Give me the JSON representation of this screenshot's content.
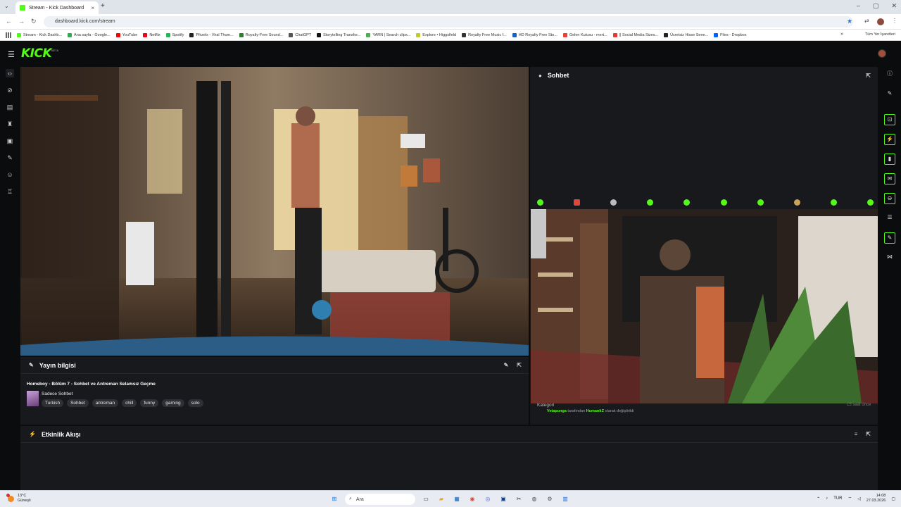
{
  "browser": {
    "tab_title": "Stream - Kick Dashboard",
    "url": "dashboard.kick.com/stream",
    "bookmarks": [
      {
        "label": "Stream - Kick Dashb...",
        "color": "#53fc18"
      },
      {
        "label": "Ana sayfa - Google...",
        "color": "#34a853"
      },
      {
        "label": "YouTube",
        "color": "#ff0000"
      },
      {
        "label": "Netflix",
        "color": "#e50914"
      },
      {
        "label": "Spotify",
        "color": "#1db954"
      },
      {
        "label": "Pikzels - Viral Thum...",
        "color": "#222222"
      },
      {
        "label": "Royalty-Free Sound...",
        "color": "#2e7d32"
      },
      {
        "label": "ChatGPT",
        "color": "#555555"
      },
      {
        "label": "Storytelling Transfor...",
        "color": "#111111"
      },
      {
        "label": "YARN | Search clips...",
        "color": "#4caf50"
      },
      {
        "label": "Explore • Higgsfield",
        "color": "#c0ca33"
      },
      {
        "label": "Royalty Free Music f...",
        "color": "#333333"
      },
      {
        "label": "HD Royalty Free Sto...",
        "color": "#1565c0"
      },
      {
        "label": "Gelen Kutusu - mert...",
        "color": "#ea4335"
      },
      {
        "label": "|| Social Media Sizes...",
        "color": "#e53935"
      },
      {
        "label": "Ücretsiz Hisse Sene...",
        "color": "#222222"
      },
      {
        "label": "Files - Dropbox",
        "color": "#0061fe"
      }
    ],
    "other_bookmarks": "Tüm Yer İşaretleri"
  },
  "kick": {
    "logo": "KICK",
    "logo_tag": "BETA",
    "accent": "#53fc18",
    "chat": {
      "title": "Sohbet",
      "category_label": "Kategori",
      "time_ago": "15 saat önce",
      "change_user": "Vetapunga",
      "change_mid": " tarafından ",
      "change_value": "HumanitZ",
      "change_end": " olarak değiştirildi"
    },
    "info": {
      "title": "Yayın bilgisi",
      "stream_title": "Homeboy - Bölüm 7 - Sohbet ve Antreman Selamsız Geçme",
      "category": "Sadece Sohbet",
      "tags": [
        "Turkish",
        "Sohbet",
        "antreman",
        "chill",
        "funny",
        "gaming",
        "solo"
      ]
    },
    "activity": {
      "title": "Etkinlik Akışı"
    }
  },
  "taskbar": {
    "temperature": "13°C",
    "weather": "Güneşli",
    "search": "Ara",
    "lang": "TUR",
    "time": "14:08",
    "date": "27.03.2026"
  }
}
